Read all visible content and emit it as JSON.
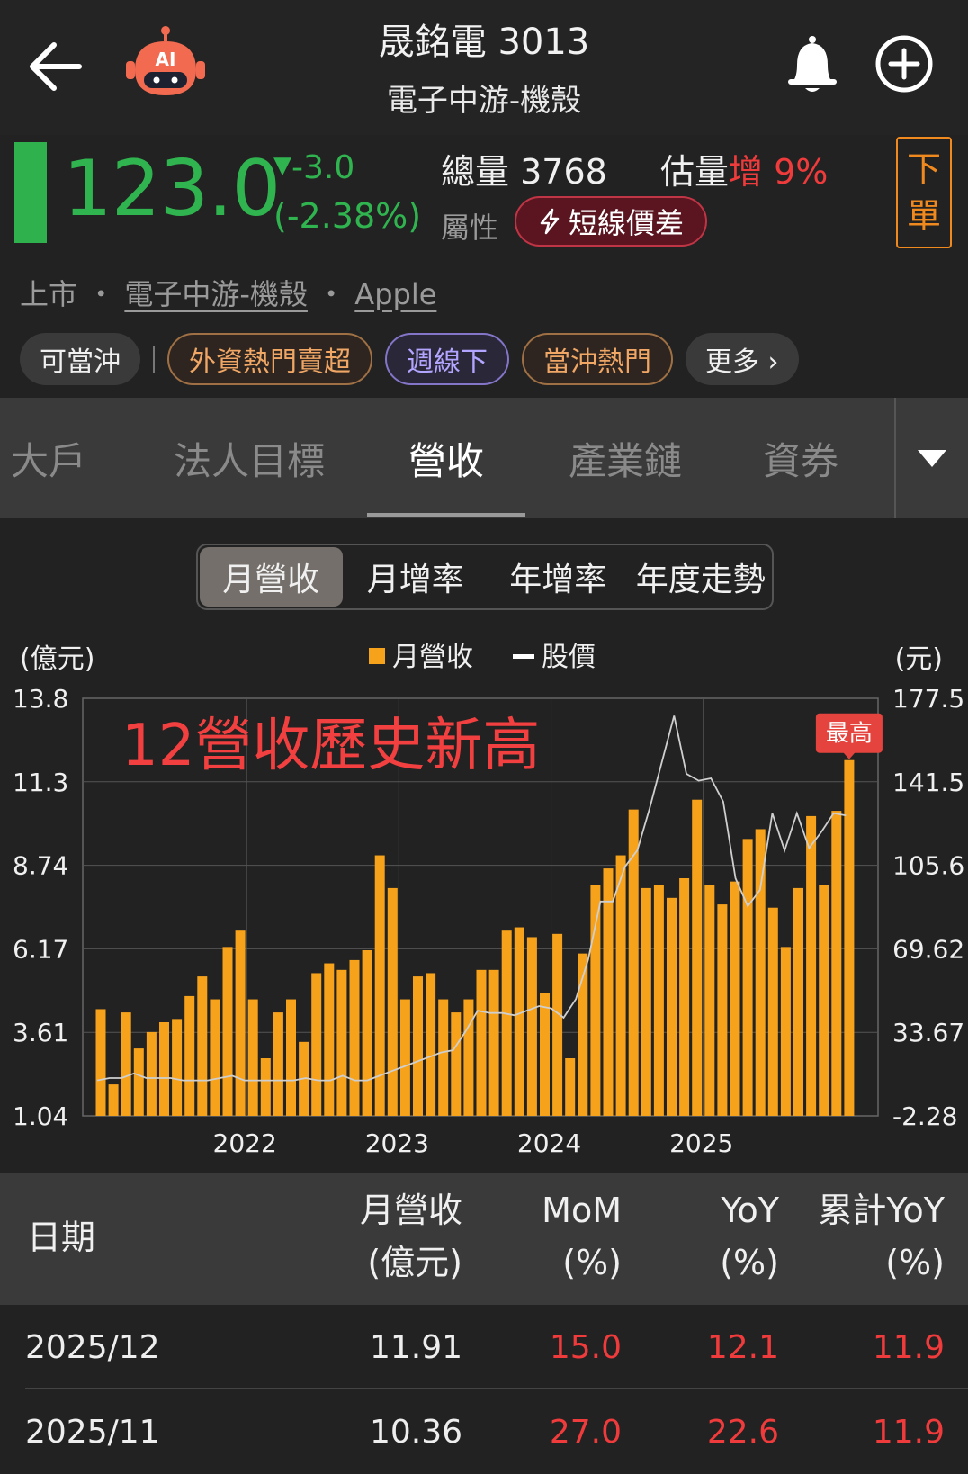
{
  "header": {
    "title": "晟銘電 3013",
    "subtitle": "電子中游-機殼",
    "ai_label": "AI"
  },
  "quote": {
    "price": "123.0",
    "change": "-3.0",
    "change_pct": "(-2.38%)",
    "volume_label": "總量",
    "volume": "3768",
    "est_label": "估量",
    "est_dir": "增",
    "est_pct": "9%",
    "attr_label": "屬性",
    "attr_badge": "短線價差",
    "order_btn": [
      "下",
      "單"
    ],
    "colors": {
      "down": "#30b44f",
      "up": "#ef3b3b",
      "accent": "#f08a1e"
    }
  },
  "breadcrumb": {
    "market": "上市",
    "sep": "・",
    "industry": "電子中游-機殼",
    "concept": "Apple"
  },
  "tags": {
    "first": "可當沖",
    "items": [
      {
        "label": "外資熱門賣超",
        "style": "brown"
      },
      {
        "label": "週線下",
        "style": "purple"
      },
      {
        "label": "當沖熱門",
        "style": "brown"
      }
    ],
    "more": "更多 ›"
  },
  "section_tabs": [
    "大戶",
    "法人目標",
    "營收",
    "產業鏈",
    "資券"
  ],
  "active_section_tab": "營收",
  "segment": {
    "items": [
      "月營收",
      "月增率",
      "年增率",
      "年度走勢"
    ],
    "active": "月營收"
  },
  "chart_data": {
    "type": "bar",
    "left_unit": "(億元)",
    "right_unit": "(元)",
    "legend": [
      "月營收",
      "股價"
    ],
    "annotation": "12營收歷史新高",
    "max_label": "最高",
    "left_ticks": [
      "13.8",
      "11.3",
      "8.74",
      "6.17",
      "3.61",
      "1.04"
    ],
    "right_ticks": [
      "177.5",
      "141.5",
      "105.6",
      "69.62",
      "33.67",
      "-2.28"
    ],
    "ylim_left": [
      1.04,
      13.8
    ],
    "ylim_right": [
      -2.28,
      177.5
    ],
    "x_ticks": [
      "2022",
      "2023",
      "2024",
      "2025"
    ],
    "series": [
      {
        "name": "月營收",
        "color": "#f7a21b",
        "values": [
          4.3,
          2.0,
          4.2,
          3.1,
          3.6,
          3.9,
          4.0,
          4.7,
          5.3,
          4.6,
          6.2,
          6.7,
          4.6,
          2.8,
          4.2,
          4.6,
          3.3,
          5.4,
          5.7,
          5.5,
          5.8,
          6.1,
          9.0,
          8.0,
          4.6,
          5.3,
          5.4,
          4.6,
          4.2,
          4.6,
          5.5,
          5.5,
          6.7,
          6.8,
          6.5,
          4.8,
          6.6,
          2.8,
          6.0,
          8.1,
          8.6,
          9.0,
          10.4,
          8.0,
          8.1,
          7.7,
          8.3,
          10.7,
          8.1,
          7.5,
          8.2,
          9.5,
          9.8,
          7.4,
          6.2,
          8.0,
          10.2,
          8.1,
          10.36,
          11.91
        ]
      },
      {
        "name": "股價",
        "color": "#cfcfcf",
        "values": [
          13,
          14,
          14,
          16,
          14,
          14,
          14,
          13,
          13,
          13,
          14,
          15,
          13,
          13,
          13,
          13,
          13,
          14,
          13,
          13,
          15,
          13,
          13,
          15,
          17,
          19,
          21,
          23,
          25,
          26,
          34,
          43,
          42,
          42,
          41,
          43,
          45,
          44,
          40,
          48,
          65,
          90,
          90,
          105,
          112,
          130,
          150,
          170,
          145,
          142,
          143,
          133,
          100,
          88,
          95,
          128,
          112,
          128,
          113,
          120,
          128,
          127
        ]
      }
    ]
  },
  "table": {
    "headers": {
      "date": "日期",
      "rev": [
        "月營收",
        "(億元)"
      ],
      "mom": [
        "MoM",
        "(%)"
      ],
      "yoy": [
        "YoY",
        "(%)"
      ],
      "cum": [
        "累計YoY",
        "(%)"
      ]
    },
    "rows": [
      {
        "date": "2025/12",
        "rev": "11.91",
        "mom": "15.0",
        "yoy": "12.1",
        "cum": "11.9"
      },
      {
        "date": "2025/11",
        "rev": "10.36",
        "mom": "27.0",
        "yoy": "22.6",
        "cum": "11.9"
      }
    ]
  }
}
